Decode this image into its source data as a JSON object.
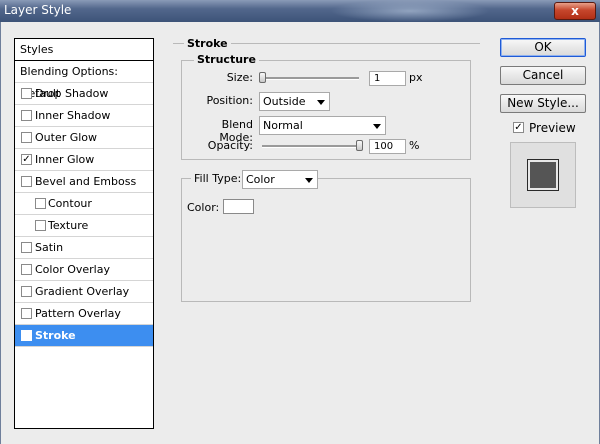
{
  "window": {
    "title": "Layer Style",
    "close_symbol": "x"
  },
  "style_list": {
    "header": "Styles",
    "blending_options": "Blending Options: Default",
    "items": [
      {
        "label": "Drop Shadow",
        "checked": false,
        "check": ""
      },
      {
        "label": "Inner Shadow",
        "checked": false,
        "check": ""
      },
      {
        "label": "Outer Glow",
        "checked": false,
        "check": ""
      },
      {
        "label": "Inner Glow",
        "checked": true,
        "check": "✓"
      },
      {
        "label": "Bevel and Emboss",
        "checked": false,
        "check": ""
      },
      {
        "label": "Contour",
        "checked": false,
        "check": ""
      },
      {
        "label": "Texture",
        "checked": false,
        "check": ""
      },
      {
        "label": "Satin",
        "checked": false,
        "check": ""
      },
      {
        "label": "Color Overlay",
        "checked": false,
        "check": ""
      },
      {
        "label": "Gradient Overlay",
        "checked": false,
        "check": ""
      },
      {
        "label": "Pattern Overlay",
        "checked": false,
        "check": ""
      },
      {
        "label": "Stroke",
        "checked": true,
        "check": "✓",
        "selected": true
      }
    ]
  },
  "stroke": {
    "title": "Stroke",
    "structure": {
      "title": "Structure",
      "size_label": "Size:",
      "size_value": "1",
      "size_unit": "px",
      "size_slider_fraction": 0.0,
      "position_label": "Position:",
      "position_value": "Outside",
      "blend_mode_label": "Blend Mode:",
      "blend_mode_value": "Normal",
      "opacity_label": "Opacity:",
      "opacity_value": "100",
      "opacity_unit": "%",
      "opacity_slider_fraction": 1.0
    },
    "fill": {
      "fill_type_label": "Fill Type:",
      "fill_type_value": "Color",
      "color_label": "Color:",
      "color_value": "#ffffff"
    }
  },
  "buttons": {
    "ok": "OK",
    "cancel": "Cancel",
    "new_style": "New Style..."
  },
  "preview": {
    "label": "Preview",
    "checked": true,
    "check": "✓",
    "swatch_color": "#555555"
  }
}
